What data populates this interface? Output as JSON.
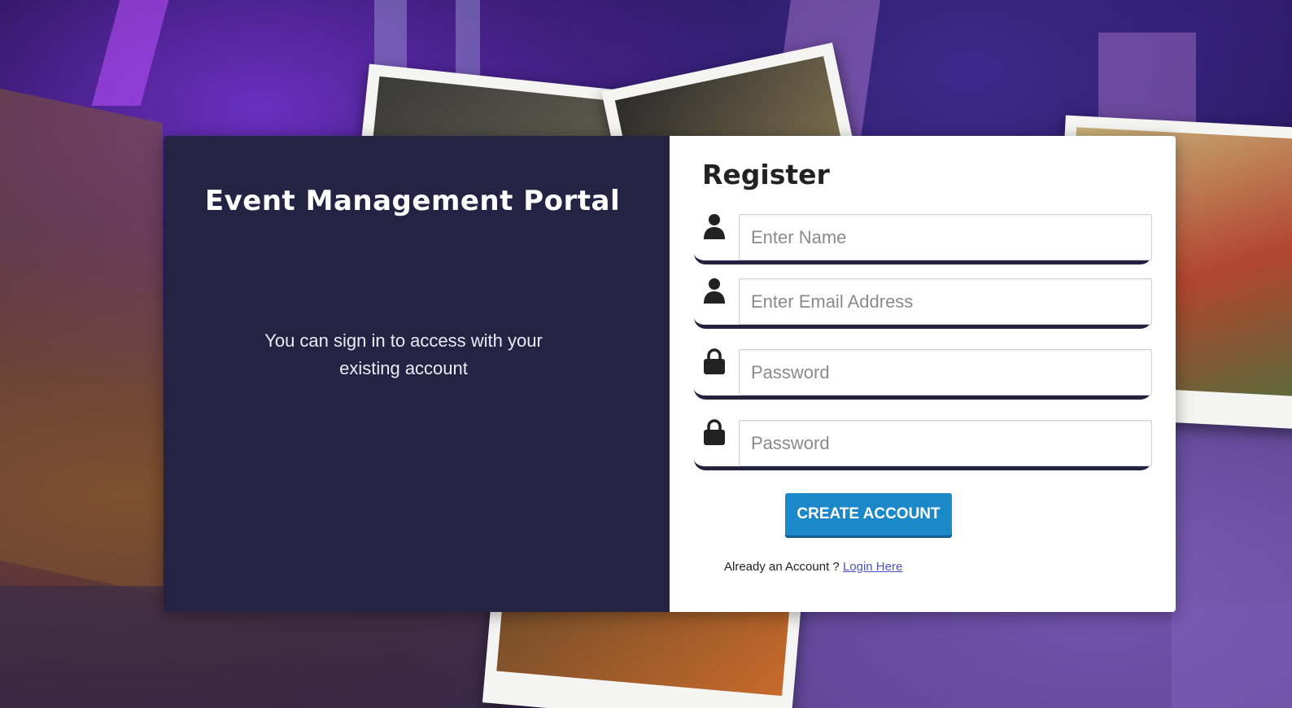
{
  "left_panel": {
    "title": "Event Management Portal",
    "subtitle": "You can sign in to access with your existing account"
  },
  "register": {
    "title": "Register",
    "fields": [
      {
        "icon": "user-icon",
        "placeholder": "Enter Name",
        "value": ""
      },
      {
        "icon": "user-icon",
        "placeholder": "Enter Email Address",
        "value": ""
      },
      {
        "icon": "lock-icon",
        "placeholder": "Password",
        "value": ""
      },
      {
        "icon": "lock-icon",
        "placeholder": "Password",
        "value": ""
      }
    ],
    "submit_label": "CREATE ACCOUNT",
    "already_text": "Already an Account ? ",
    "login_link": "Login Here"
  },
  "colors": {
    "left_panel_bg": "#242344",
    "button_bg": "#1a88c9",
    "field_underline": "#23213f",
    "link": "#4a53c9"
  }
}
